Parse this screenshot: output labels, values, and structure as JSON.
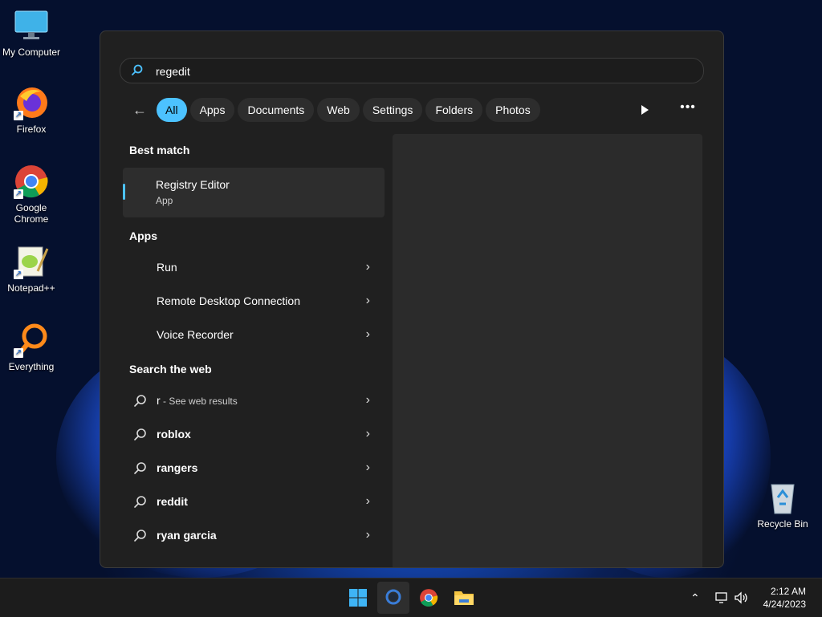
{
  "desktop": {
    "icons": [
      {
        "label": "My Computer"
      },
      {
        "label": "Firefox"
      },
      {
        "label": "Google Chrome"
      },
      {
        "label": "Notepad++"
      },
      {
        "label": "Everything"
      },
      {
        "label": "Recycle Bin"
      }
    ]
  },
  "search": {
    "query": "regedit",
    "filters": [
      "All",
      "Apps",
      "Documents",
      "Web",
      "Settings",
      "Folders",
      "Photos"
    ],
    "active_filter": "All",
    "sections": {
      "best_match": "Best match",
      "apps": "Apps",
      "web": "Search the web"
    },
    "best_match": {
      "title": "Registry Editor",
      "subtitle": "App"
    },
    "apps": [
      {
        "label": "Run"
      },
      {
        "label": "Remote Desktop Connection"
      },
      {
        "label": "Voice Recorder"
      }
    ],
    "web_first": {
      "prefix": "r",
      "suffix": " - See web results"
    },
    "web_suggestions": [
      "roblox",
      "rangers",
      "reddit",
      "ryan garcia"
    ]
  },
  "taskbar": {
    "time": "2:12 AM",
    "date": "4/24/2023"
  },
  "colors": {
    "accent": "#4cc2ff",
    "panel": "#202020"
  }
}
